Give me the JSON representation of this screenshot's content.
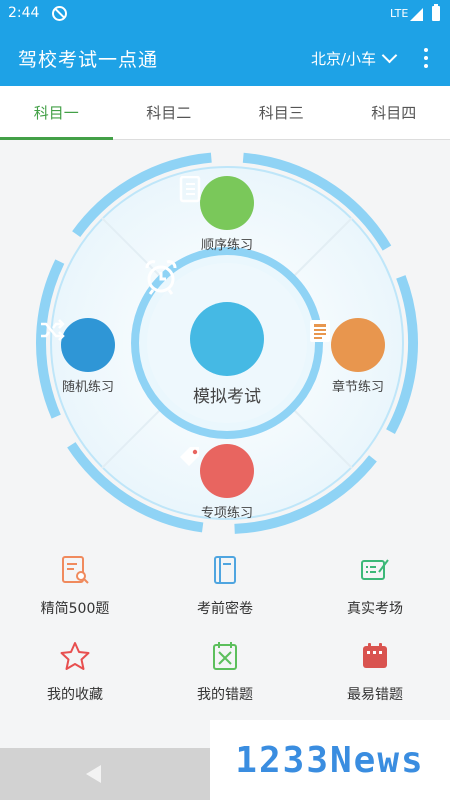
{
  "status_bar": {
    "time": "2:44",
    "network": "LTE"
  },
  "app_bar": {
    "title": "驾校考试一点通",
    "city_select": "北京/小车"
  },
  "tabs": [
    {
      "label": "科目一",
      "active": true
    },
    {
      "label": "科目二",
      "active": false
    },
    {
      "label": "科目三",
      "active": false
    },
    {
      "label": "科目四",
      "active": false
    }
  ],
  "wheel": {
    "top": {
      "label": "顺序练习",
      "icon": "document-list-icon",
      "color": "#7ac85a"
    },
    "left": {
      "label": "随机练习",
      "icon": "shuffle-icon",
      "color": "#2f96d6"
    },
    "right": {
      "label": "章节练习",
      "icon": "chapter-document-icon",
      "color": "#e8964e"
    },
    "bottom": {
      "label": "专项练习",
      "icon": "tag-icon",
      "color": "#e86560"
    },
    "center": {
      "label": "模拟考试",
      "icon": "alarm-clock-icon",
      "color": "#45b9e4"
    }
  },
  "grid": [
    [
      {
        "label": "精简500题",
        "icon": "search-document-icon",
        "color": "#f08a5d"
      },
      {
        "label": "考前密卷",
        "icon": "book-icon",
        "color": "#4fa5e0"
      },
      {
        "label": "真实考场",
        "icon": "exam-edit-icon",
        "color": "#3cb878"
      }
    ],
    [
      {
        "label": "我的收藏",
        "icon": "star-icon",
        "color": "#e84f4f"
      },
      {
        "label": "我的错题",
        "icon": "wrong-questions-icon",
        "color": "#5cbf5c"
      },
      {
        "label": "最易错题",
        "icon": "calendar-icon",
        "color": "#d9534f"
      }
    ]
  ],
  "watermark": "1233News"
}
